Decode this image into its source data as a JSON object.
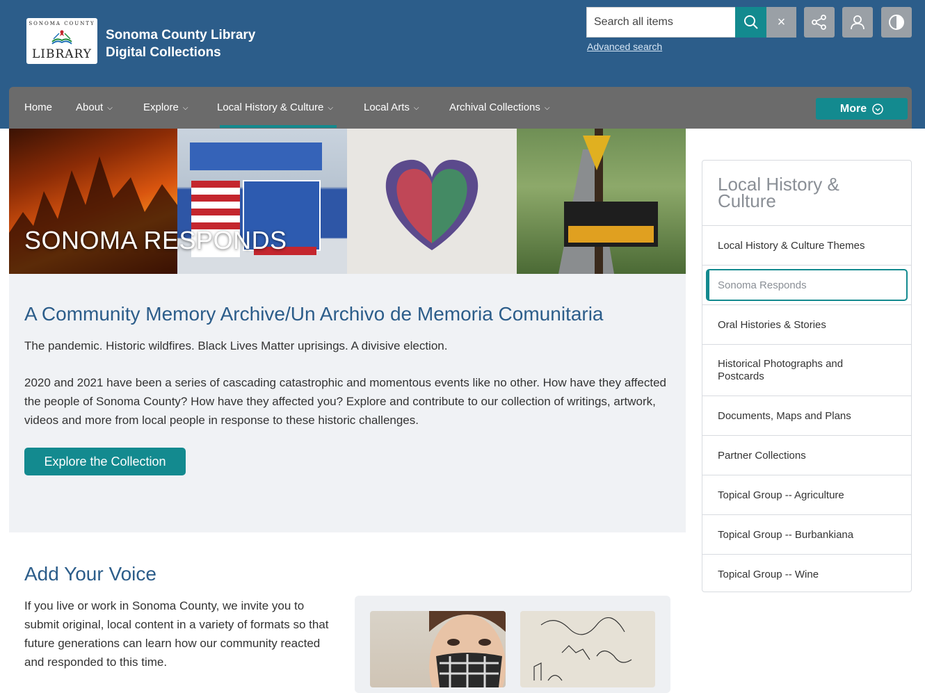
{
  "header": {
    "logo_arc_text": "SONOMA COUNTY",
    "logo_text": "LIBRARY",
    "title_line1": "Sonoma County Library",
    "title_line2": "Digital Collections"
  },
  "search": {
    "placeholder": "Search all items",
    "advanced_label": "Advanced search",
    "clear_glyph": "×"
  },
  "nav": {
    "items": [
      {
        "label": "Home"
      },
      {
        "label": "About"
      },
      {
        "label": "Explore"
      },
      {
        "label": "Local History & Culture"
      },
      {
        "label": "Local Arts"
      },
      {
        "label": "Archival Collections"
      }
    ],
    "more_label": "More",
    "active_color": "#138a8f"
  },
  "banner": {
    "title": "SONOMA RESPONDS"
  },
  "intro": {
    "heading": "A Community Memory Archive/Un Archivo de Memoria Comunitaria",
    "para1": "The pandemic. Historic wildfires. Black Lives Matter uprisings. A divisive election.",
    "para2": "2020 and 2021 have been a series of cascading catastrophic and momentous events like no other. How have they affected the people of Sonoma County? How have they affected you? Explore and contribute to our collection of writings, artwork, videos and more from local people in response to these historic challenges.",
    "button_label": "Explore the Collection"
  },
  "voice": {
    "heading": "Add Your Voice",
    "text": "If you live or work in Sonoma County, we invite you to submit original, local content in a variety of formats so that future generations can learn how our community reacted and responded to this time."
  },
  "sidebar": {
    "heading": "Local History & Culture",
    "items": [
      {
        "label": "Local History & Culture Themes"
      },
      {
        "label": "Sonoma Responds",
        "active": true
      },
      {
        "label": "Oral Histories & Stories"
      },
      {
        "label": "Historical Photographs and Postcards"
      },
      {
        "label": "Documents, Maps and Plans"
      },
      {
        "label": "Partner Collections"
      },
      {
        "label": "Topical Group -- Agriculture"
      },
      {
        "label": "Topical Group -- Burbankiana"
      },
      {
        "label": "Topical Group -- Wine"
      }
    ]
  },
  "colors": {
    "header_bg": "#2c5d8a",
    "nav_bg": "#6b6b6b",
    "accent": "#138a8f"
  },
  "icons": [
    "search-icon",
    "close-icon",
    "share-icon",
    "user-icon",
    "contrast-icon",
    "chevron-down-icon",
    "chevron-circle-icon"
  ]
}
